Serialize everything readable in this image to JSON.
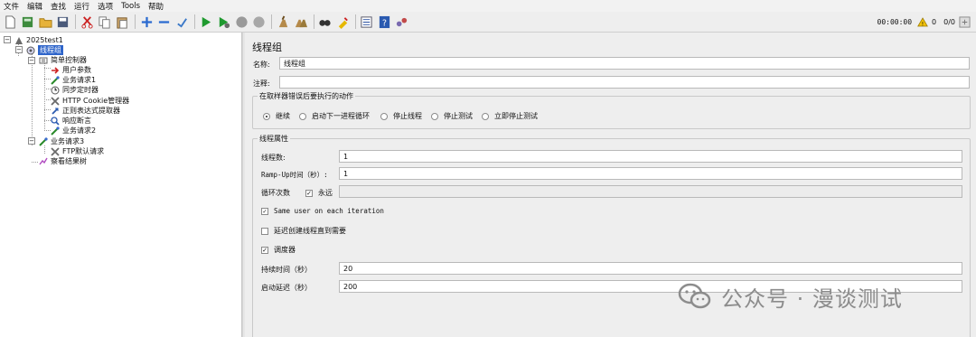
{
  "menu": [
    "文件",
    "编辑",
    "查找",
    "运行",
    "选项",
    "Tools",
    "帮助"
  ],
  "toolbar": {
    "icons": [
      "new-icon",
      "templates-icon",
      "open-icon",
      "save-icon",
      "cut-icon",
      "copy-icon",
      "paste-icon",
      "add-icon",
      "remove-icon",
      "toggle-icon",
      "start-icon",
      "start-no-pause-icon",
      "stop-icon",
      "shutdown-icon",
      "clear-icon",
      "clear-all-icon",
      "search-icon",
      "reset-search-icon",
      "function-helper-icon",
      "help-icon",
      "remote-icon"
    ],
    "timer": "00:00:00",
    "warning_count": "0",
    "threads": "0/0"
  },
  "tree": {
    "nodes": [
      {
        "label": "2025test1",
        "icon": "test-plan-icon"
      },
      {
        "label": "线程组",
        "icon": "thread-group-icon"
      },
      {
        "label": "简单控制器",
        "icon": "controller-icon"
      },
      {
        "label": "用户参数",
        "icon": "preprocessor-icon"
      },
      {
        "label": "业务请求1",
        "icon": "sampler-icon"
      },
      {
        "label": "同步定时器",
        "icon": "timer-icon"
      },
      {
        "label": "HTTP Cookie管理器",
        "icon": "config-icon"
      },
      {
        "label": "正则表达式提取器",
        "icon": "postprocessor-icon"
      },
      {
        "label": "响应断言",
        "icon": "assertion-icon"
      },
      {
        "label": "业务请求2",
        "icon": "sampler-icon"
      },
      {
        "label": "业务请求3",
        "icon": "sampler-icon"
      },
      {
        "label": "FTP默认请求",
        "icon": "config-icon"
      },
      {
        "label": "察看结果树",
        "icon": "listener-icon"
      }
    ]
  },
  "panel": {
    "title": "线程组",
    "name_label": "名称:",
    "name_value": "线程组",
    "comment_label": "注释:",
    "comment_value": "",
    "error_action": {
      "legend": "在取样器错误后要执行的动作",
      "options": [
        "继续",
        "启动下一进程循环",
        "停止线程",
        "停止测试",
        "立即停止测试"
      ],
      "selected": "继续"
    },
    "props": {
      "legend": "线程属性",
      "threads_label": "线程数:",
      "threads_value": "1",
      "rampup_label": "Ramp-Up时间（秒）:",
      "rampup_value": "1",
      "loop_label": "循环次数",
      "forever_label": "永远",
      "forever_checked": true,
      "loop_value": "",
      "same_user_label": "Same user on each iteration",
      "same_user_checked": true,
      "delay_label": "延迟创建线程直到需要",
      "delay_checked": false,
      "scheduler_label": "调度器",
      "scheduler_checked": true,
      "duration_label": "持续时间（秒）",
      "duration_value": "20",
      "startup_delay_label": "启动延迟（秒）",
      "startup_delay_value": "200"
    }
  },
  "watermark": "公众号 · 漫谈测试"
}
